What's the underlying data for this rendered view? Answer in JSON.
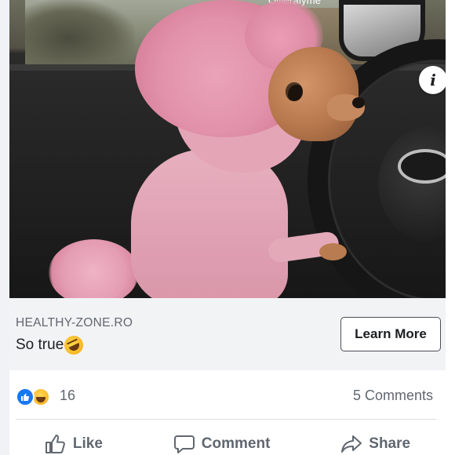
{
  "photo": {
    "watermark": "Ollieraiyme",
    "info_icon": "info-icon",
    "info_glyph": "i"
  },
  "ad": {
    "domain": "HEALTHY-ZONE.RO",
    "headline": "So true",
    "headline_emoji": "rolling-on-floor-laughing-emoji",
    "cta_label": "Learn More"
  },
  "engagement": {
    "reaction_icons": [
      "like-reaction-icon",
      "haha-reaction-icon"
    ],
    "reaction_count": "16",
    "comments_label": "5 Comments"
  },
  "actions": {
    "like_label": "Like",
    "comment_label": "Comment",
    "share_label": "Share"
  },
  "colors": {
    "accent_blue": "#1877f2",
    "text_secondary": "#606770",
    "text_primary": "#1c1e21",
    "ad_bar_bg": "#f2f3f5"
  }
}
